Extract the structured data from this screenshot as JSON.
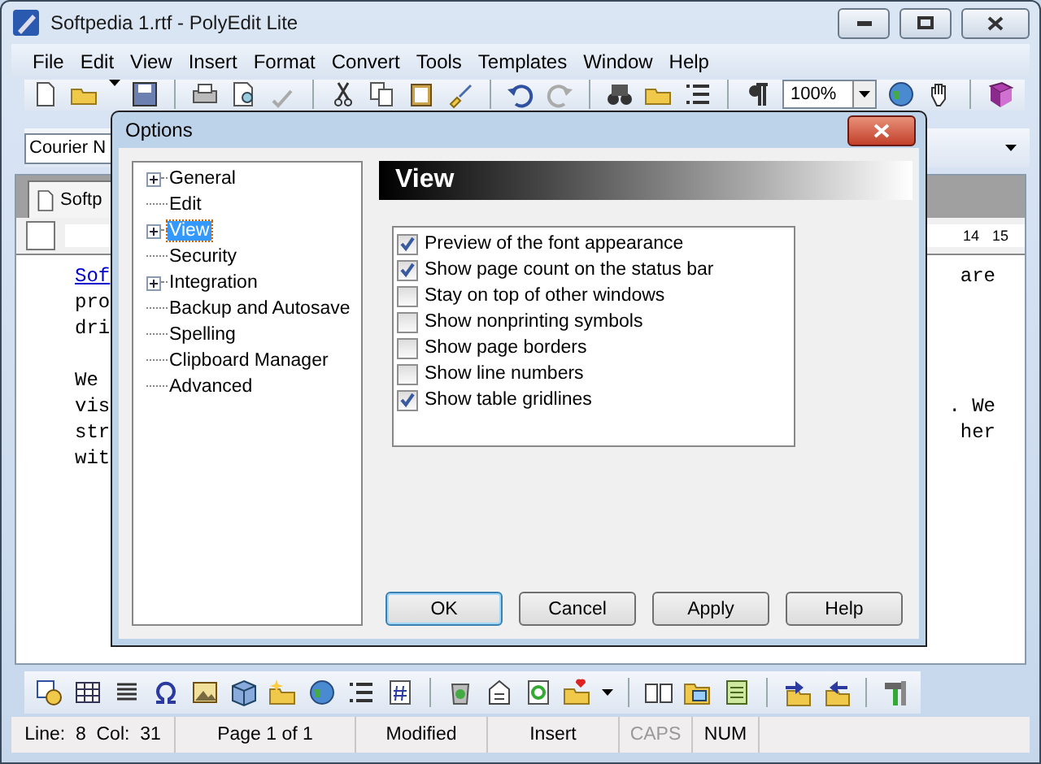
{
  "window": {
    "title": "Softpedia 1.rtf - PolyEdit Lite"
  },
  "menu": [
    "File",
    "Edit",
    "View",
    "Insert",
    "Format",
    "Convert",
    "Tools",
    "Templates",
    "Window",
    "Help"
  ],
  "toolbar": {
    "zoom": "100%"
  },
  "font_bar": {
    "font": "Courier N"
  },
  "document_tab": {
    "label": "Softp"
  },
  "ruler": {
    "numbers": [
      "14",
      "15"
    ]
  },
  "editor": {
    "paragraphs": [
      {
        "lines": [
          {
            "left": "Sof",
            "right": "are",
            "link": true
          },
          {
            "left": "pro",
            "link": false
          },
          {
            "left": "dri",
            "link": false
          }
        ]
      },
      {
        "lines": [
          {
            "left": "We",
            "link": false
          },
          {
            "left": "vis",
            "right": ". We",
            "link": false
          },
          {
            "left": "str",
            "right": "her",
            "link": false
          },
          {
            "left": "wit",
            "link": false
          }
        ]
      }
    ]
  },
  "dialog": {
    "title": "Options",
    "tree": [
      {
        "label": "General",
        "has_children": true,
        "selected": false
      },
      {
        "label": "Edit",
        "has_children": false,
        "selected": false
      },
      {
        "label": "View",
        "has_children": true,
        "selected": true
      },
      {
        "label": "Security",
        "has_children": false,
        "selected": false
      },
      {
        "label": "Integration",
        "has_children": true,
        "selected": false
      },
      {
        "label": "Backup and Autosave",
        "has_children": false,
        "selected": false
      },
      {
        "label": "Spelling",
        "has_children": false,
        "selected": false
      },
      {
        "label": "Clipboard Manager",
        "has_children": false,
        "selected": false
      },
      {
        "label": "Advanced",
        "has_children": false,
        "selected": false
      }
    ],
    "section_title": "View",
    "options": [
      {
        "label": "Preview of the font appearance",
        "checked": true
      },
      {
        "label": "Show page count on the status bar",
        "checked": true
      },
      {
        "label": "Stay on top of other windows",
        "checked": false
      },
      {
        "label": "Show nonprinting symbols",
        "checked": false
      },
      {
        "label": "Show page borders",
        "checked": false
      },
      {
        "label": "Show line numbers",
        "checked": false
      },
      {
        "label": "Show table gridlines",
        "checked": true
      }
    ],
    "buttons": [
      {
        "label": "OK",
        "default": true
      },
      {
        "label": "Cancel",
        "default": false
      },
      {
        "label": "Apply",
        "default": false
      },
      {
        "label": "Help",
        "default": false
      }
    ]
  },
  "status_bar": [
    {
      "text": "Line:  8  Col:  31",
      "disabled": false
    },
    {
      "text": "Page 1 of 1",
      "disabled": false
    },
    {
      "text": "Modified",
      "disabled": false
    },
    {
      "text": "Insert",
      "disabled": false
    },
    {
      "text": "CAPS",
      "disabled": true
    },
    {
      "text": "NUM",
      "disabled": false
    }
  ]
}
